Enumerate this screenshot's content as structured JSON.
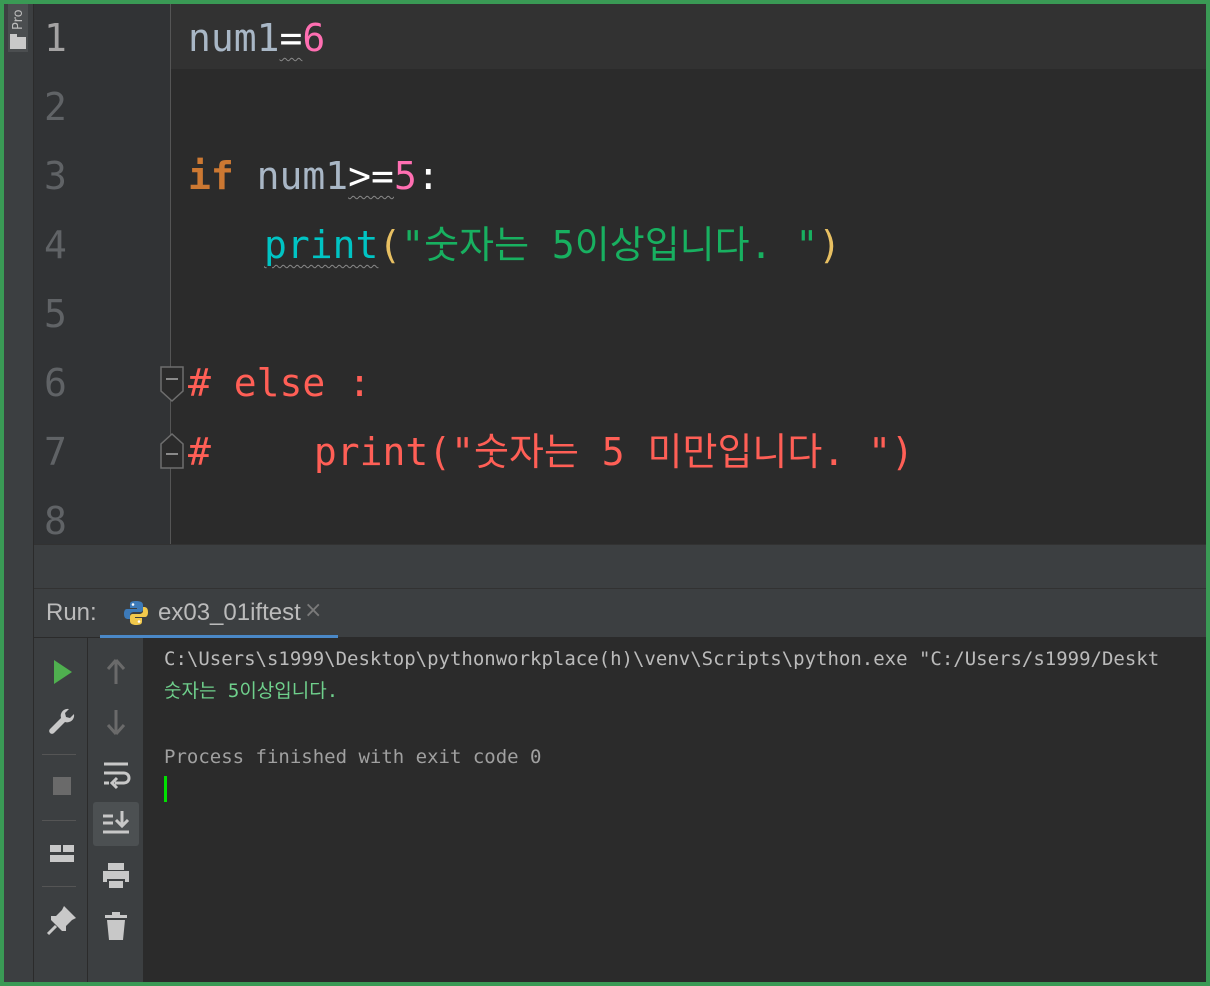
{
  "sidebar": {
    "project_tab_label": "Pro"
  },
  "editor": {
    "line_numbers": [
      "1",
      "2",
      "3",
      "4",
      "5",
      "6",
      "7",
      "8"
    ],
    "line1": {
      "var": "num1",
      "op": "=",
      "num": "6"
    },
    "line3": {
      "kw": "if",
      "var": "num1",
      "op": ">=",
      "num": "5",
      "colon": ":"
    },
    "line4": {
      "builtin": "print",
      "open": "(",
      "str": "\"숫자는 5이상입니다. \"",
      "close": ")"
    },
    "line6": {
      "comment": "# else :"
    },
    "line7": {
      "hash": "#",
      "comment": "print(\"숫자는 5 미만입니다. \")"
    }
  },
  "run_window": {
    "label": "Run:",
    "tab_title": "ex03_01iftest",
    "close_glyph": "×"
  },
  "console": {
    "command": "C:\\Users\\s1999\\Desktop\\pythonworkplace(h)\\venv\\Scripts\\python.exe \"C:/Users/s1999/Deskt",
    "output": "숫자는 5이상입니다.",
    "exit_message": "Process finished with exit code 0"
  },
  "colors": {
    "keyword": "#cc7832",
    "number": "#ff6fb2",
    "builtin": "#00c4c4",
    "comment": "#ff5f56",
    "tab_underline": "#4a88c7",
    "caret": "#00e000",
    "run_green": "#4fb04f"
  }
}
